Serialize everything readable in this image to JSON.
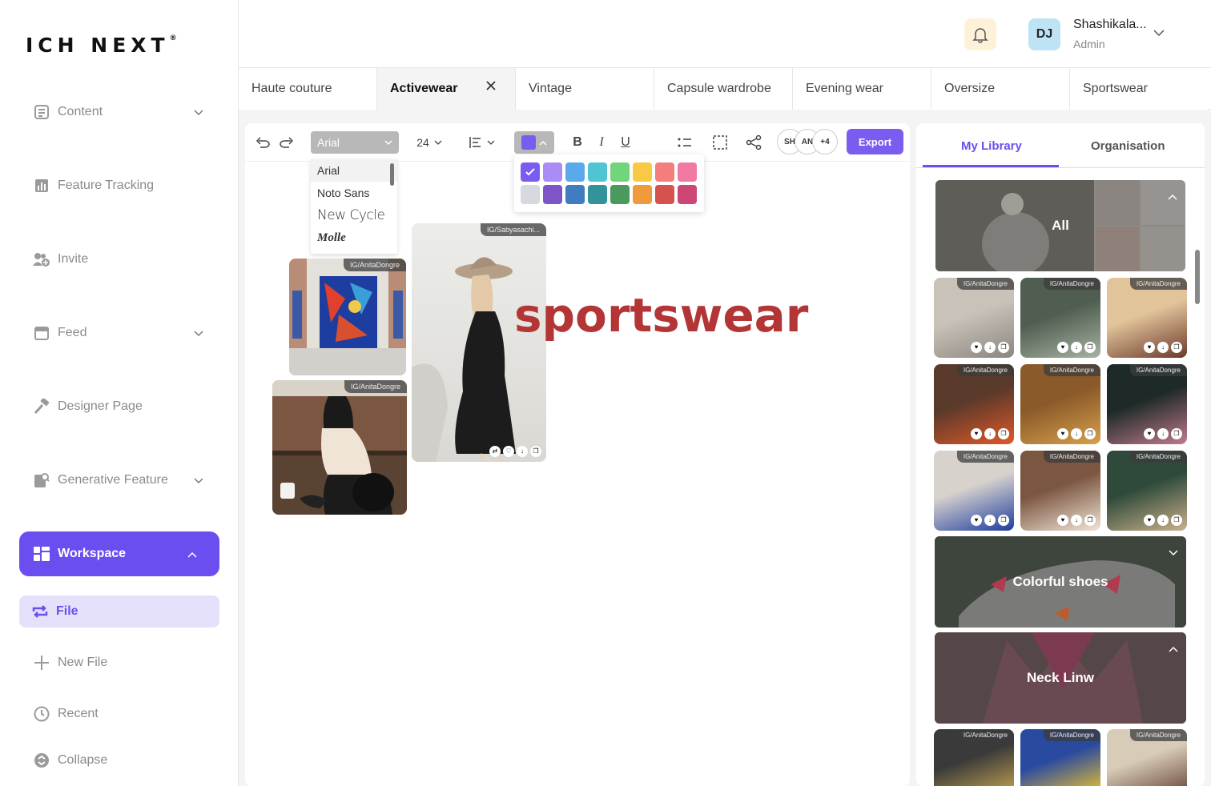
{
  "brand": {
    "logo": "ICH NEXT",
    "reg": "®"
  },
  "sidebar": {
    "items": [
      {
        "label": "Content",
        "icon": "content-icon",
        "has_chevron": true
      },
      {
        "label": "Feature Tracking",
        "icon": "chart-icon",
        "has_chevron": false
      },
      {
        "label": "Invite",
        "icon": "invite-icon",
        "has_chevron": false
      },
      {
        "label": "Feed",
        "icon": "feed-icon",
        "has_chevron": true
      },
      {
        "label": "Designer Page",
        "icon": "hammer-icon",
        "has_chevron": false
      },
      {
        "label": "Generative Feature",
        "icon": "generative-icon",
        "has_chevron": true
      }
    ],
    "workspace": {
      "label": "Workspace",
      "icon": "grid-icon"
    },
    "sub_items": [
      {
        "label": "File",
        "icon": "file-icon",
        "active": true
      },
      {
        "label": "New File",
        "icon": "plus-icon"
      },
      {
        "label": "Recent",
        "icon": "clock-icon"
      },
      {
        "label": "Collapse",
        "icon": "collapse-icon"
      }
    ],
    "accent": "#6c4ef0"
  },
  "header": {
    "user": {
      "initials": "DJ",
      "name": "Shashikala...",
      "role": "Admin"
    }
  },
  "tabs": [
    "Haute couture",
    "Activewear",
    "Vintage",
    "Capsule wardrobe",
    "Evening wear",
    "Oversize",
    "Sportswear"
  ],
  "active_tab": "Activewear",
  "toolbar": {
    "font": "Arial",
    "size": "24",
    "export_label": "Export",
    "collaborators": [
      "SH",
      "AN",
      "+4"
    ],
    "font_options": [
      "Arial",
      "Noto Sans",
      "New Cycle",
      "Molle"
    ],
    "palette": [
      "#7b5cf0",
      "#a98cf5",
      "#5aa9ec",
      "#4fc4d3",
      "#72d47b",
      "#f8c945",
      "#f47d7d",
      "#f07aa2",
      "#d6d9de",
      "#7d55c7",
      "#3f7cc0",
      "#33939b",
      "#4a9a5e",
      "#ef9a3c",
      "#d6524f",
      "#cc4677"
    ],
    "selected_color": "#7b5cf0"
  },
  "canvas": {
    "text": "sportswear",
    "text_color": "#b33536",
    "photos": [
      {
        "tag": "IG/Sabyasachi..."
      },
      {
        "tag": "IG/AnitaDongre"
      },
      {
        "tag": "IG/AnitaDongre"
      }
    ]
  },
  "library": {
    "tabs": [
      "My Library",
      "Organisation"
    ],
    "collections": [
      "All",
      "Colorful shoes",
      "Neck Linw"
    ],
    "tile_tag": "IG/AnitaDongre"
  }
}
